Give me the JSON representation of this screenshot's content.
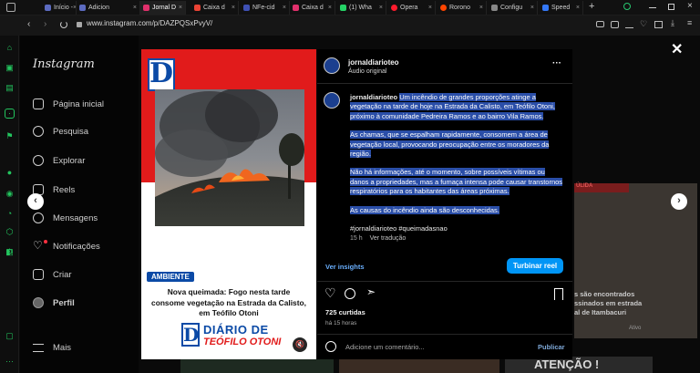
{
  "browser": {
    "tabs": [
      {
        "label": "Início -",
        "color": "#5c6bc0"
      },
      {
        "label": "Adicion",
        "color": "#5c6bc0"
      },
      {
        "label": "Jornal D",
        "color": "#e1306c",
        "active": true
      },
      {
        "label": "Caixa d",
        "color": "#ea4335"
      },
      {
        "label": "NFe-cid",
        "color": "#3f51b5"
      },
      {
        "label": "Caixa d",
        "color": "#e1306c"
      },
      {
        "label": "(1) Wha",
        "color": "#25d366"
      },
      {
        "label": "Opera",
        "color": "#ff1b2d"
      },
      {
        "label": "Rorono",
        "color": "#ff4500"
      },
      {
        "label": "Configu",
        "color": "#888888"
      },
      {
        "label": "Speed",
        "color": "#3478f6"
      }
    ],
    "url": "www.instagram.com/p/DAZPQSxPvyV/"
  },
  "instagram": {
    "logo": "Instagram",
    "nav": [
      {
        "label": "Página inicial",
        "icon": "home-icon"
      },
      {
        "label": "Pesquisa",
        "icon": "search-icon"
      },
      {
        "label": "Explorar",
        "icon": "explore-icon"
      },
      {
        "label": "Reels",
        "icon": "reels-icon"
      },
      {
        "label": "Mensagens",
        "icon": "messages-icon"
      },
      {
        "label": "Notificações",
        "icon": "heart-icon"
      },
      {
        "label": "Criar",
        "icon": "create-icon"
      },
      {
        "label": "Perfil",
        "icon": "avatar"
      }
    ],
    "more": "Mais"
  },
  "post_image": {
    "logo_letter": "D",
    "badge": "AMBIENTE",
    "headline": "Nova queimada: Fogo nesta tarde consome vegetação na Estrada da Calisto, em Teófilo Otoni",
    "brand_line1": "DIÁRIO DE",
    "brand_line2": "TEÓFILO OTONI"
  },
  "post": {
    "username": "jornaldiarioteo",
    "audio": "Áudio original",
    "caption_user": "jornaldiarioteo",
    "caption_p1": "Um incêndio de grandes proporções atinge a vegetação na tarde de hoje na Estrada da Calisto, em Teófilo Otoni, próximo à comunidade Pedreira Ramos e ao bairro Vila Ramos.",
    "caption_p2": "As chamas, que se espalham rapidamente, consomem a área de vegetação local, provocando preocupação entre os moradores da região.",
    "caption_p3": "Não há informações, até o momento, sobre possíveis vítimas ou danos a propriedades, mas a fumaça intensa pode causar transtornos respiratórios para os habitantes das áreas próximas.",
    "caption_p4": "As causas do incêndio ainda são desconhecidas.",
    "hashtags": "#jornaldiarioteo #queimadasnao",
    "time": "15 h",
    "translate": "Ver tradução",
    "insights": "Ver insights",
    "boost": "Turbinar reel",
    "likes": "725 curtidas",
    "posted": "há 15 horas",
    "comment_placeholder": "Adicione um comentário...",
    "publish": "Publicar"
  },
  "background_posts": {
    "text1": "s são encontrados",
    "text2": "ssinados em estrada",
    "text3": "al de Itambacuri",
    "text4": "ATENÇÃO !",
    "text5": "ÚLIDA",
    "text6": "Ativo"
  }
}
